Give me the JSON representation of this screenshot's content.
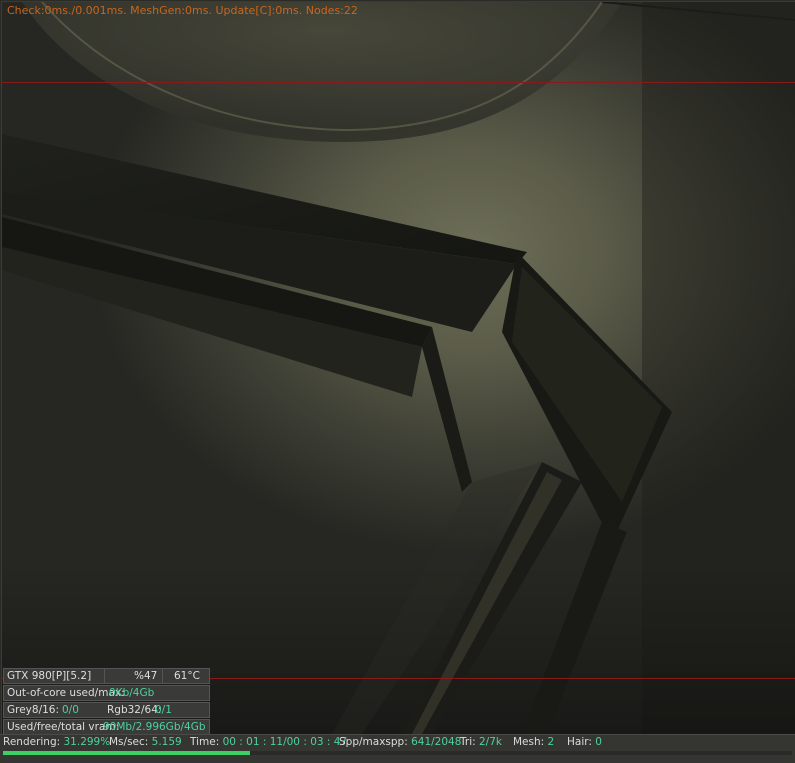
{
  "viewport": {
    "stats_text": "Check:0ms./0.001ms. MeshGen:0ms. Update[C]:0ms. Nodes:22"
  },
  "gpu_panel": {
    "device": "GTX 980[P][5.2]",
    "usage": "%47",
    "temperature": "61°C",
    "out_of_core_label": "Out-of-core used/max:",
    "out_of_core_value": "0Kb/4Gb",
    "grey_label": "Grey8/16:",
    "grey_value": "0/0",
    "rgb_label": "Rgb32/64:",
    "rgb_value": "0/1",
    "vram_label": "Used/free/total vram:",
    "vram_value": "90Mb/2.996Gb/4Gb"
  },
  "statusbar": {
    "rendering_label": "Rendering:",
    "rendering_value": "31.299%",
    "ms_label": "Ms/sec:",
    "ms_value": "5.159",
    "time_label": "Time:",
    "time_value": "00 : 01 : 11/00 : 03 : 47",
    "spp_label": "Spp/maxspp:",
    "spp_value": "641/2048",
    "tri_label": "Tri:",
    "tri_value": "2/7k",
    "mesh_label": "Mesh:",
    "mesh_value": "2",
    "hair_label": "Hair:",
    "hair_value": "0",
    "progress": 0.313
  },
  "colors": {
    "stats_text": "#c8661e",
    "value_text": "#4fd0a0",
    "progress_bar": "#3cd064",
    "region_line": "#8a1a1a"
  }
}
